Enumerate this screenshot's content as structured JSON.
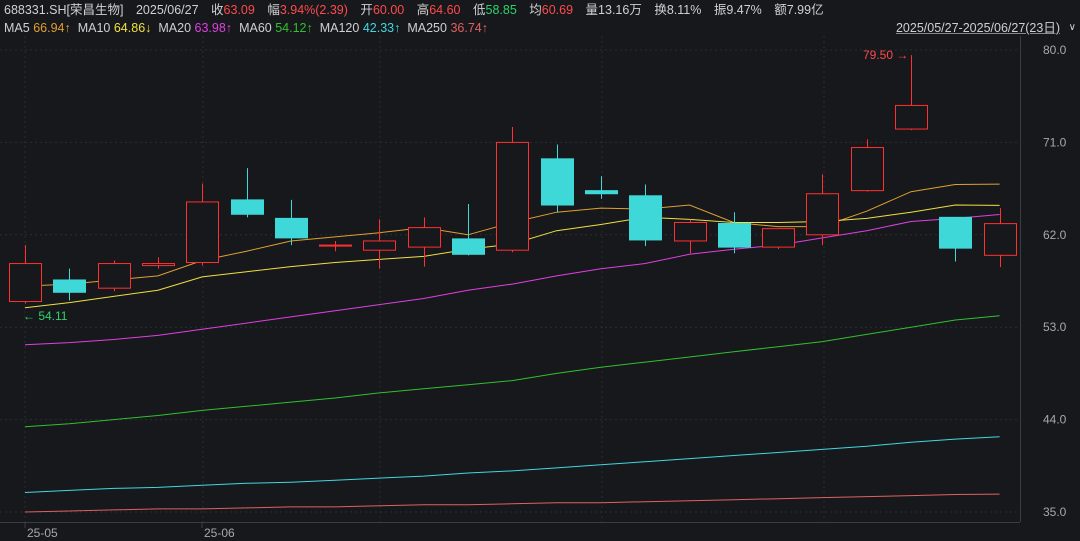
{
  "header": {
    "ticker": "688331.SH[荣昌生物]",
    "date": "2025/06/27",
    "close_label": "收",
    "close": "63.09",
    "change_label": "幅",
    "change": "3.94%(2.39)",
    "open_label": "开",
    "open": "60.00",
    "high_label": "高",
    "high": "64.60",
    "low_label": "低",
    "low": "58.85",
    "avg_label": "均",
    "avg": "60.69",
    "volume": "量13.16万",
    "turnover": "换8.11%",
    "amplitude": "振9.47%",
    "amount": "额7.99亿",
    "range": "2025/05/27-2025/06/27(23日)",
    "range_caret": "∨"
  },
  "ma_legend": [
    {
      "label": "MA5",
      "value": "66.94↑",
      "color": "#e0a030"
    },
    {
      "label": "MA10",
      "value": "64.86↓",
      "color": "#f0e040"
    },
    {
      "label": "MA20",
      "value": "63.98↑",
      "color": "#e040e0"
    },
    {
      "label": "MA60",
      "value": "54.12↑",
      "color": "#30c030"
    },
    {
      "label": "MA120",
      "value": "42.33↑",
      "color": "#40d8e0"
    },
    {
      "label": "MA250",
      "value": "36.74↑",
      "color": "#e06060"
    }
  ],
  "colors": {
    "up": "#ff3030",
    "down": "#3fd8d8",
    "grid": "#2a2d33",
    "axis_text": "#a8a8a8"
  },
  "chart_data": {
    "type": "candlestick",
    "x_tick_labels": [
      "25-05",
      "25-06"
    ],
    "y_ticks": [
      "80.0",
      "71.0",
      "62.0",
      "53.0",
      "44.0",
      "35.0"
    ],
    "ylim": [
      35.0,
      80.0
    ],
    "candles": [
      {
        "o": 55.5,
        "h": 61.0,
        "l": 55.3,
        "c": 59.2
      },
      {
        "o": 57.6,
        "h": 58.7,
        "l": 55.6,
        "c": 56.4
      },
      {
        "o": 56.8,
        "h": 59.5,
        "l": 56.5,
        "c": 59.2
      },
      {
        "o": 59.0,
        "h": 59.8,
        "l": 58.7,
        "c": 59.2
      },
      {
        "o": 59.3,
        "h": 67.0,
        "l": 59.0,
        "c": 65.2
      },
      {
        "o": 65.4,
        "h": 68.5,
        "l": 63.7,
        "c": 64.0
      },
      {
        "o": 63.6,
        "h": 65.4,
        "l": 61.0,
        "c": 61.7
      },
      {
        "o": 60.9,
        "h": 61.4,
        "l": 60.4,
        "c": 61.0
      },
      {
        "o": 60.5,
        "h": 63.5,
        "l": 58.7,
        "c": 61.4
      },
      {
        "o": 60.8,
        "h": 63.7,
        "l": 58.9,
        "c": 62.7
      },
      {
        "o": 61.6,
        "h": 65.0,
        "l": 60.0,
        "c": 60.1
      },
      {
        "o": 60.5,
        "h": 72.5,
        "l": 60.3,
        "c": 71.0
      },
      {
        "o": 69.4,
        "h": 70.8,
        "l": 64.2,
        "c": 64.9
      },
      {
        "o": 66.3,
        "h": 67.7,
        "l": 65.5,
        "c": 66.0
      },
      {
        "o": 65.8,
        "h": 66.9,
        "l": 60.9,
        "c": 61.5
      },
      {
        "o": 61.4,
        "h": 63.5,
        "l": 60.2,
        "c": 63.2
      },
      {
        "o": 63.1,
        "h": 64.2,
        "l": 60.2,
        "c": 60.8
      },
      {
        "o": 60.8,
        "h": 62.5,
        "l": 60.6,
        "c": 62.6
      },
      {
        "o": 62.0,
        "h": 67.9,
        "l": 61.0,
        "c": 66.0
      },
      {
        "o": 66.3,
        "h": 71.3,
        "l": 66.2,
        "c": 70.5
      },
      {
        "o": 72.3,
        "h": 79.5,
        "l": 72.2,
        "c": 74.6
      },
      {
        "o": 63.7,
        "h": 63.7,
        "l": 59.4,
        "c": 60.7
      },
      {
        "o": 60.0,
        "h": 64.6,
        "l": 58.85,
        "c": 63.09
      }
    ],
    "ma_series": [
      {
        "name": "MA5",
        "values": [
          57.0,
          57.2,
          57.6,
          58.0,
          59.5,
          60.4,
          61.4,
          61.8,
          62.2,
          62.7,
          62.0,
          63.2,
          64.2,
          64.6,
          64.5,
          64.9,
          63.2,
          62.8,
          62.8,
          64.3,
          66.2,
          66.9,
          66.94
        ]
      },
      {
        "name": "MA10",
        "values": [
          54.9,
          55.4,
          56.0,
          56.6,
          57.9,
          58.4,
          58.9,
          59.3,
          59.6,
          59.9,
          60.6,
          61.1,
          62.4,
          63.0,
          63.7,
          63.5,
          63.2,
          63.2,
          63.3,
          63.6,
          64.2,
          64.9,
          64.86
        ]
      },
      {
        "name": "MA20",
        "values": [
          51.3,
          51.5,
          51.8,
          52.2,
          52.8,
          53.4,
          54.0,
          54.6,
          55.2,
          55.8,
          56.6,
          57.2,
          58.0,
          58.7,
          59.2,
          60.1,
          60.6,
          61.0,
          61.7,
          62.4,
          63.3,
          63.6,
          63.98
        ]
      },
      {
        "name": "MA60",
        "values": [
          43.3,
          43.6,
          44.0,
          44.4,
          44.9,
          45.3,
          45.7,
          46.1,
          46.6,
          47.0,
          47.4,
          47.8,
          48.5,
          49.1,
          49.6,
          50.1,
          50.6,
          51.1,
          51.6,
          52.3,
          53.0,
          53.7,
          54.12
        ]
      },
      {
        "name": "MA120",
        "values": [
          36.9,
          37.1,
          37.3,
          37.4,
          37.6,
          37.8,
          37.9,
          38.1,
          38.3,
          38.5,
          38.8,
          39.0,
          39.3,
          39.6,
          39.9,
          40.2,
          40.5,
          40.8,
          41.1,
          41.4,
          41.8,
          42.1,
          42.33
        ]
      },
      {
        "name": "MA250",
        "values": [
          35.0,
          35.1,
          35.2,
          35.3,
          35.3,
          35.4,
          35.5,
          35.5,
          35.6,
          35.7,
          35.7,
          35.8,
          35.9,
          35.9,
          36.0,
          36.1,
          36.2,
          36.3,
          36.4,
          36.5,
          36.6,
          36.7,
          36.74
        ]
      }
    ],
    "annotations": [
      {
        "text": "79.50",
        "value": 79.5,
        "candle_index": 20,
        "arrow": "→",
        "color": "#ff4a4a"
      },
      {
        "text": "54.11",
        "value": 54.11,
        "candle_index": 0,
        "arrow": "←",
        "color": "#2bd36a"
      }
    ],
    "grid": true
  }
}
